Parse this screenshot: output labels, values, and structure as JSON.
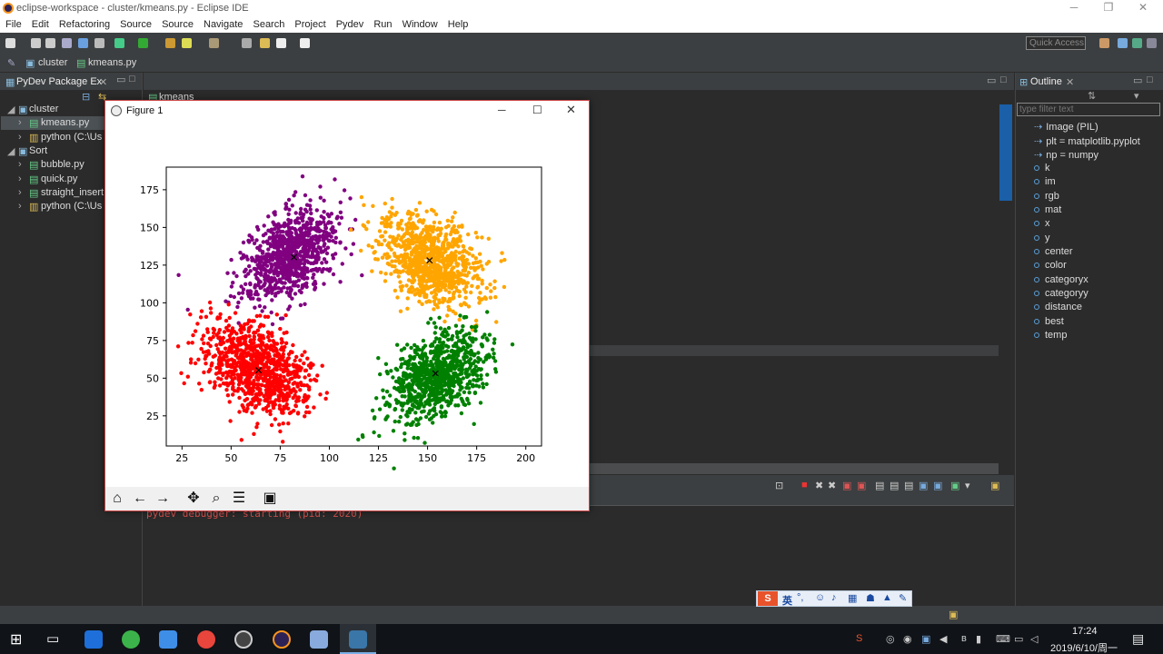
{
  "window": {
    "title": "eclipse-workspace - cluster/kmeans.py - Eclipse IDE"
  },
  "menu": [
    "File",
    "Edit",
    "Refactoring",
    "Source",
    "Source",
    "Navigate",
    "Search",
    "Project",
    "Pydev",
    "Run",
    "Window",
    "Help"
  ],
  "toolbar": {
    "quick_access_placeholder": "Quick Access"
  },
  "breadcrumb": {
    "project": "cluster",
    "file": "kmeans.py"
  },
  "package_explorer": {
    "title": "PyDev Package Ex",
    "items": [
      {
        "label": "cluster"
      },
      {
        "label": "kmeans.py"
      },
      {
        "label": "python  (C:\\Us"
      },
      {
        "label": "Sort"
      },
      {
        "label": "bubble.py"
      },
      {
        "label": "quick.py"
      },
      {
        "label": "straight_insert"
      },
      {
        "label": "python  (C:\\Us"
      }
    ]
  },
  "editor": {
    "tab": "kmeans"
  },
  "outline": {
    "title": "Outline",
    "filter_placeholder": "type filter text",
    "items": [
      "Image (PIL)",
      "plt = matplotlib.pyplot",
      "np = numpy",
      "k",
      "im",
      "rgb",
      "mat",
      "x",
      "y",
      "center",
      "color",
      "categoryx",
      "categoryy",
      "distance",
      "best",
      "temp"
    ]
  },
  "console": {
    "text": "pydev debugger: starting (pid: 2020)"
  },
  "figure": {
    "title": "Figure 1",
    "toolbar": [
      "home-icon",
      "back-icon",
      "forward-icon",
      "pan-icon",
      "zoom-icon",
      "configure-icon",
      "save-icon"
    ]
  },
  "chart_data": {
    "type": "scatter",
    "title": "",
    "xlabel": "",
    "ylabel": "",
    "xlim": [
      17,
      208
    ],
    "ylim": [
      5,
      190
    ],
    "xticks": [
      25,
      50,
      75,
      100,
      125,
      150,
      175,
      200
    ],
    "yticks": [
      25,
      50,
      75,
      100,
      125,
      150,
      175
    ],
    "grid": false,
    "series": [
      {
        "color": "#800080",
        "cx": 80,
        "cy": 132,
        "spread": [
          18,
          30
        ],
        "angle": -30
      },
      {
        "color": "#ffa500",
        "cx": 152,
        "cy": 128,
        "spread": [
          20,
          30
        ],
        "angle": 35
      },
      {
        "color": "#ff0000",
        "cx": 63,
        "cy": 55,
        "spread": [
          20,
          32
        ],
        "angle": 35
      },
      {
        "color": "#008000",
        "cx": 155,
        "cy": 52,
        "spread": [
          18,
          30
        ],
        "angle": -35
      }
    ],
    "centers": [
      {
        "x": 82,
        "y": 130
      },
      {
        "x": 151,
        "y": 128
      },
      {
        "x": 64,
        "y": 55
      },
      {
        "x": 154,
        "y": 53
      }
    ],
    "center_marker": "x"
  },
  "ime": {
    "label": "英"
  },
  "clock": {
    "time": "17:24",
    "date": "2019/6/10/周一"
  }
}
